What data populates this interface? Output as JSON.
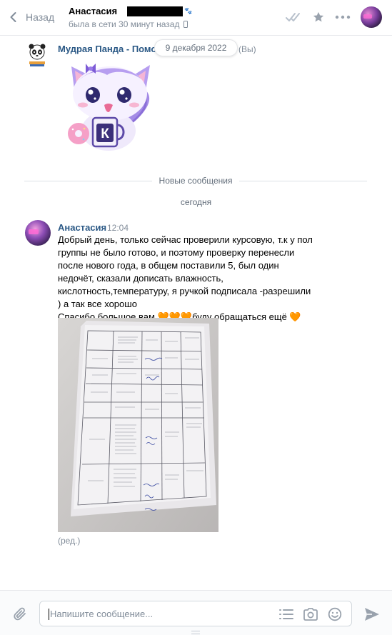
{
  "header": {
    "back_label": "Назад",
    "peer_name": "Анастасия",
    "peer_status": "была в сети 30 минут назад",
    "icons": [
      "double-check-icon",
      "star-icon",
      "more-icon"
    ]
  },
  "sticker_message": {
    "sender": "Мудрая Панда - Помо",
    "sender_suffix": "(Вы)",
    "date_pill": "9 декабря 2022",
    "sticker_letter": "К"
  },
  "dividers": {
    "new_messages": "Новые сообщения",
    "today": "сегодня"
  },
  "message": {
    "sender": "Анастасия",
    "time": "12:04",
    "text_line1": "Добрый день, только сейчас проверили курсовую, т.к у пол группы не было готово, и поэтому проверку перенесли после нового года, в общем поставили 5, был один недочёт, сказали дописать влажность, кислотность,температуру, я ручкой подписала -разрешили ) а так все хорошо",
    "text_line2_a": "Спасибо большое вам ",
    "text_line2_b": "буду обращаться ещё ",
    "emoji_heart": "🧡",
    "emoji_fire": "🔥",
    "edited_label": "(ред.)"
  },
  "composer": {
    "placeholder": "Напишите сообщение..."
  },
  "colors": {
    "link": "#2a5885",
    "muted": "#818c99",
    "divider": "#e7e8ec"
  }
}
